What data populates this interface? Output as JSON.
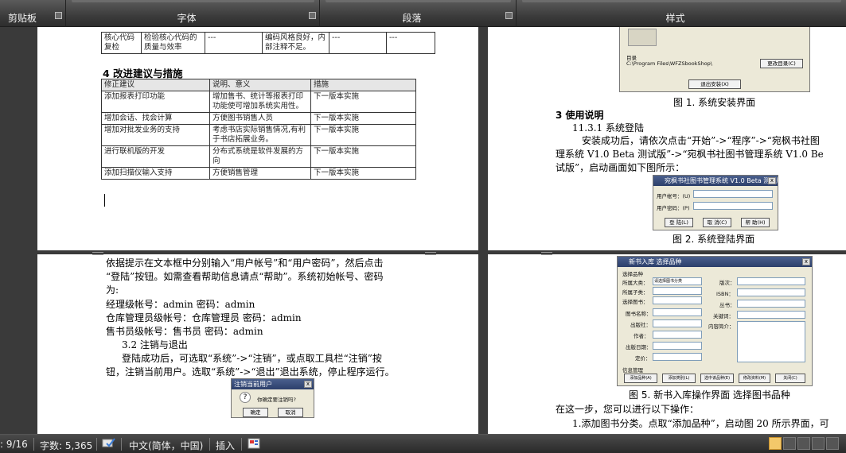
{
  "ribbon": {
    "groups": [
      {
        "label": "剪贴板"
      },
      {
        "label": "字体"
      },
      {
        "label": "段落"
      },
      {
        "label": "样式"
      }
    ]
  },
  "page1": {
    "top_table": {
      "rows": [
        [
          "核心代码复检",
          "检验核心代码的质量与效率",
          "---",
          "编码风格良好，内部注释不足。",
          "---",
          "---"
        ]
      ]
    },
    "heading": "4 改进建议与措施",
    "table": {
      "headers": [
        "修正建议",
        "说明、意义",
        "措施"
      ],
      "rows": [
        [
          "添加报表打印功能",
          "增加售书、统计等报表打印功能使可增加系统实用性。",
          "下一版本实施"
        ],
        [
          "增加会话、找会计算",
          "方便图书销售人员",
          "下一版本实施"
        ],
        [
          "增加对批发业务的支持",
          "考虑书店实际销售情况,有利于书店拓展业务。",
          "下一版本实施"
        ],
        [
          "进行联机版的开发",
          "分布式系统是软件发展的方向",
          "下一版本实施"
        ],
        [
          "添加扫描仪输入支持",
          "方便销售管理",
          "下一版本实施"
        ]
      ]
    }
  },
  "page2": {
    "install_dialog": {
      "dir_label": "目录",
      "path": "C:\\Program Files\\WFZSbookShop\\",
      "change_btn": "更改目录(C)",
      "exit_btn": "退出安装(X)"
    },
    "caption1": "图 1. 系统安装界面",
    "section": "3 使用说明",
    "subsection": "11.3.1 系统登陆",
    "para_lines": [
      "安装成功后，请依次点击“开始”->“程序”->“宛枫书社图",
      "理系统 V1.0 Beta 测试版”->“宛枫书社图书管理系统 V1.0 Be",
      "试版”，启动画面如下图所示："
    ],
    "login_dialog": {
      "title": "宛枫书社图书管理系统 V1.0 Beta 测试版 登陆",
      "user_label": "用户帐号：(U)",
      "pwd_label": "用户密码：(P)",
      "buttons": [
        "登 陆(L)",
        "取 消(C)",
        "帮 助(H)"
      ]
    },
    "caption2": "图 2. 系统登陆界面"
  },
  "page3": {
    "lines": [
      "依据提示在文本框中分别输入“用户帐号”和“用户密码”，然后点击",
      "“登陆”按钮。如需查看帮助信息请点“帮助”。系统初始帐号、密码",
      "为:",
      "经理级帐号：admin   密码：admin",
      "仓库管理员级帐号：仓库管理员   密码：admin",
      "售书员级帐号：售书员   密码：admin"
    ],
    "subsection": "3.2 注销与退出",
    "para_lines": [
      "登陆成功后，可选取“系统”->“注销”，或点取工具栏“注销”按",
      "钮，注销当前用户。选取“系统”->“退出”退出系统，停止程序运行。"
    ],
    "logout_dialog": {
      "title": "注销当前用户",
      "question": "你确定要注销吗?",
      "ok": "确定",
      "cancel": "取消"
    }
  },
  "page4": {
    "book_dialog": {
      "title": "新书入库   选择品种",
      "section": "选择品种",
      "left_fields": [
        "所属大类：",
        "所属子类：",
        "选择图书：",
        "图书名称：",
        "出版社：",
        "作者：",
        "出版日期：",
        "定价："
      ],
      "combo_value": "请选择图书分类",
      "right_fields": [
        "版次：",
        "ISBN：",
        "丛书：",
        "关键词：",
        "内容简介："
      ],
      "bottom_section": "信息管理",
      "buttons": [
        "添加品种(A)",
        "添加类别(L)",
        "选中该品种(E)",
        "修改资料(M)",
        "关闭(C)"
      ]
    },
    "caption": "图 5. 新书入库操作界面  选择图书品种",
    "lines": [
      "在这一步，您可以进行以下操作：",
      "1.添加图书分类。点取“添加品种”，启动图 20 所示界面，可"
    ]
  },
  "status": {
    "page": ": 9/16",
    "words": "字数: 5,365",
    "language": "中文(简体，中国)",
    "mode": "插入"
  }
}
